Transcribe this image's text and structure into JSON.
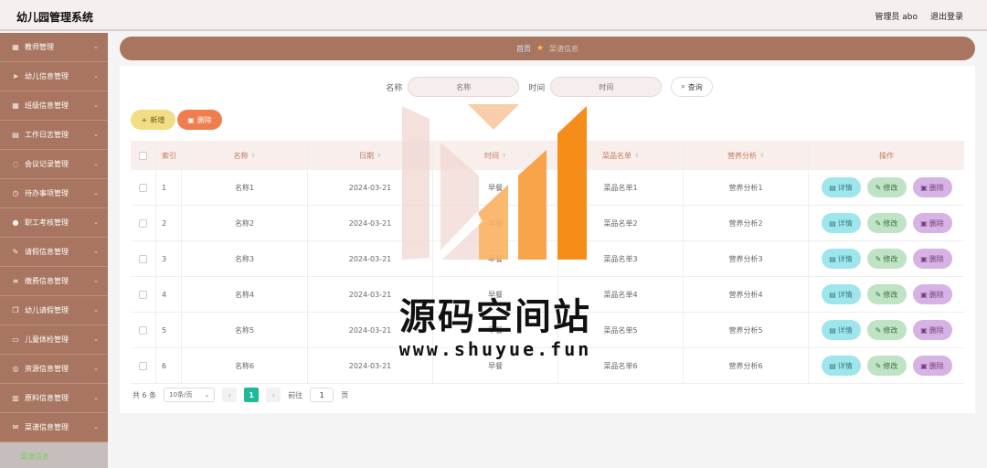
{
  "header": {
    "title": "幼儿园管理系统",
    "user": "管理员 abo",
    "logout": "退出登录"
  },
  "sidebar": {
    "items": [
      {
        "label": "教师管理",
        "icon": "grid-icon"
      },
      {
        "label": "幼儿信息管理",
        "icon": "send-icon"
      },
      {
        "label": "班级信息管理",
        "icon": "grid-icon"
      },
      {
        "label": "工作日志管理",
        "icon": "folder-icon"
      },
      {
        "label": "会议记录管理",
        "icon": "chat-icon"
      },
      {
        "label": "待办事项管理",
        "icon": "clock-icon"
      },
      {
        "label": "职工考核管理",
        "icon": "user-icon"
      },
      {
        "label": "请假信息管理",
        "icon": "edit-icon"
      },
      {
        "label": "缴费信息管理",
        "icon": "list-icon"
      },
      {
        "label": "幼儿请假管理",
        "icon": "copy-icon"
      },
      {
        "label": "儿童体检管理",
        "icon": "doc-icon"
      },
      {
        "label": "资源信息管理",
        "icon": "globe-icon"
      },
      {
        "label": "原料信息管理",
        "icon": "chart-icon"
      },
      {
        "label": "菜谱信息管理",
        "icon": "mail-icon"
      }
    ],
    "active_sub": "菜谱信息"
  },
  "breadcrumb": {
    "home": "首页",
    "current": "菜谱信息"
  },
  "search": {
    "name_label": "名称",
    "name_placeholder": "名称",
    "time_label": "时间",
    "time_placeholder": "时间",
    "query_button": "查询"
  },
  "actions": {
    "add": "新增",
    "delete": "删除"
  },
  "table": {
    "headers": {
      "index": "索引",
      "name": "名称",
      "date": "日期",
      "time": "时间",
      "menu": "菜品名单",
      "nutrition": "营养分析",
      "ops": "操作"
    },
    "op_labels": {
      "detail": "详情",
      "edit": "修改",
      "delete": "删除"
    },
    "rows": [
      {
        "index": "1",
        "name": "名称1",
        "date": "2024-03-21",
        "time": "早餐",
        "menu": "菜品名单1",
        "nutrition": "营养分析1"
      },
      {
        "index": "2",
        "name": "名称2",
        "date": "2024-03-21",
        "time": "早餐",
        "menu": "菜品名单2",
        "nutrition": "营养分析2"
      },
      {
        "index": "3",
        "name": "名称3",
        "date": "2024-03-21",
        "time": "早餐",
        "menu": "菜品名单3",
        "nutrition": "营养分析3"
      },
      {
        "index": "4",
        "name": "名称4",
        "date": "2024-03-21",
        "time": "早餐",
        "menu": "菜品名单4",
        "nutrition": "营养分析4"
      },
      {
        "index": "5",
        "name": "名称5",
        "date": "2024-03-21",
        "time": "早餐",
        "menu": "菜品名单5",
        "nutrition": "营养分析5"
      },
      {
        "index": "6",
        "name": "名称6",
        "date": "2024-03-21",
        "time": "早餐",
        "menu": "菜品名单6",
        "nutrition": "营养分析6"
      }
    ]
  },
  "pagination": {
    "total": "共 6 条",
    "page_size": "10条/页",
    "current_page": "1",
    "goto_label": "前往",
    "goto_value": "1",
    "page_unit": "页"
  },
  "watermark": {
    "text": "源码空间站",
    "url": "www.shuyue.fun"
  },
  "colors": {
    "sidebar": "#a87660",
    "accent_green": "#1fb89a",
    "add_button": "#f0dd84",
    "delete_button": "#f07d4d"
  }
}
